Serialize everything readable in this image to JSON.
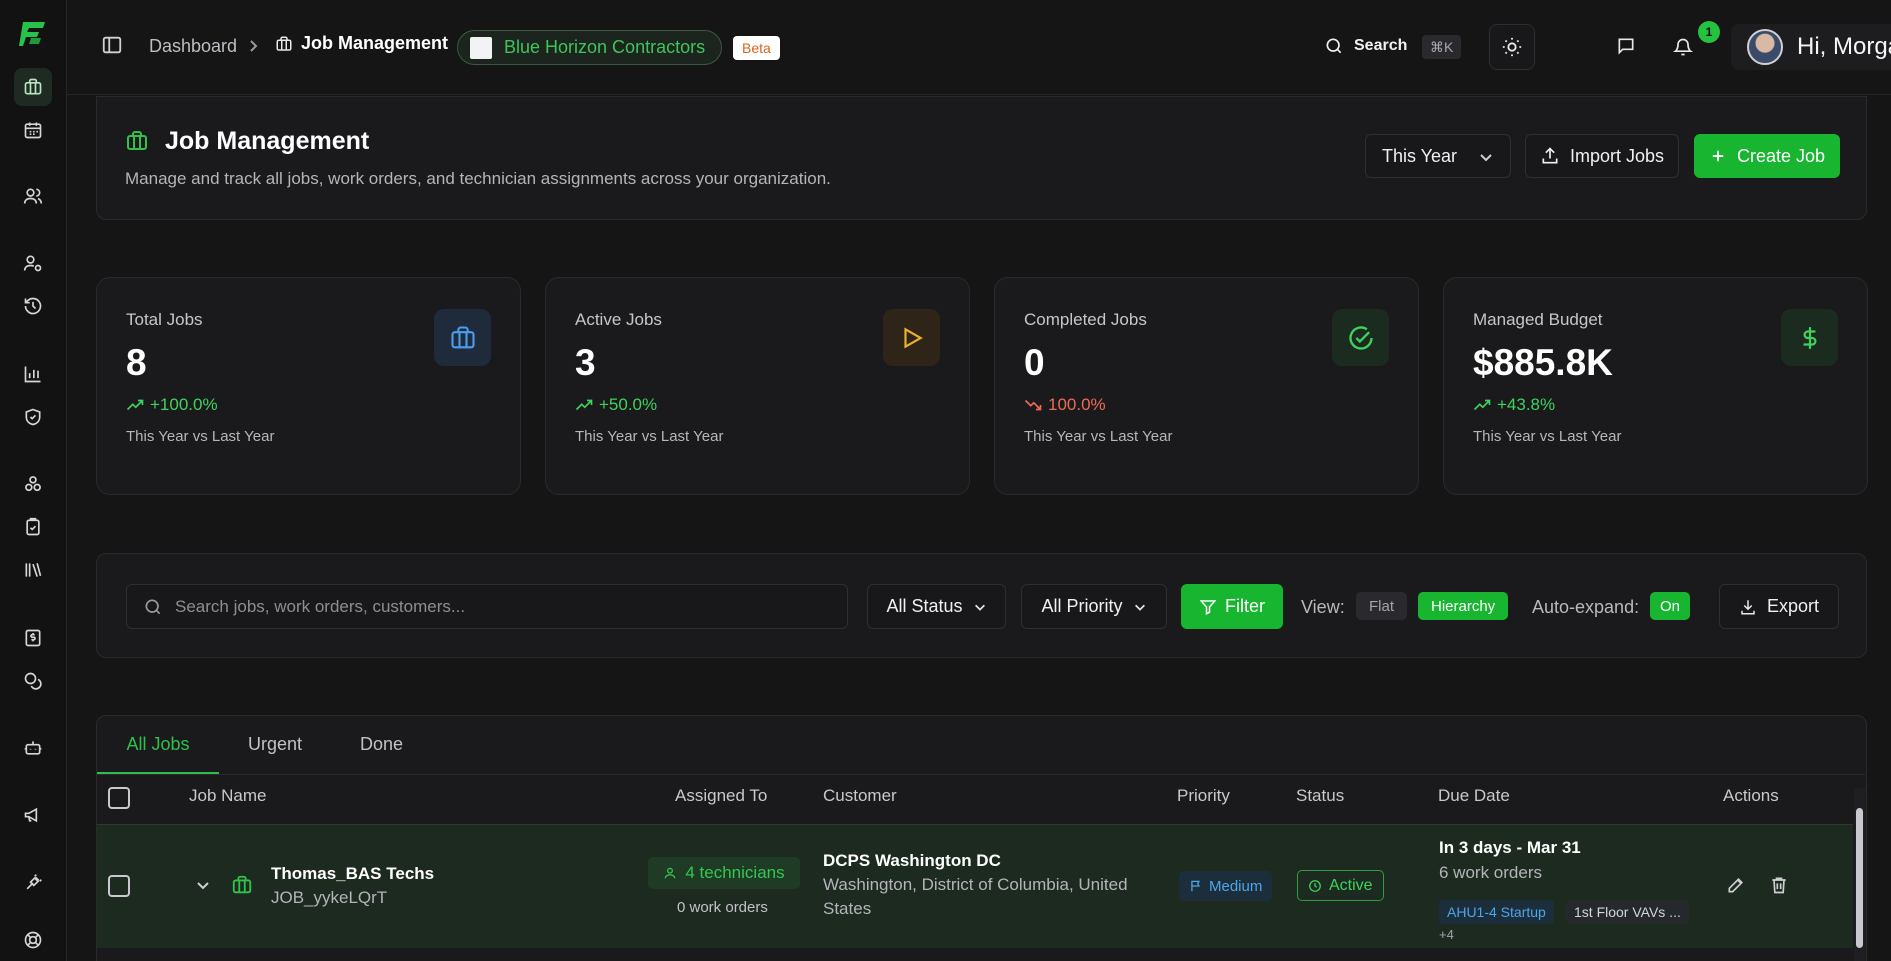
{
  "sidebar": {
    "logo_icon": "brand-logo-icon",
    "items": [
      {
        "icon": "briefcase-icon",
        "active": true
      },
      {
        "icon": "calendar-icon"
      },
      {
        "icon": "users-icon"
      },
      {
        "icon": "user-settings-icon"
      },
      {
        "icon": "history-icon"
      },
      {
        "icon": "bar-chart-icon"
      },
      {
        "icon": "shield-check-icon"
      },
      {
        "icon": "components-icon"
      },
      {
        "icon": "clipboard-check-icon"
      },
      {
        "icon": "library-icon"
      },
      {
        "icon": "invoice-icon"
      },
      {
        "icon": "coins-icon"
      },
      {
        "icon": "bot-icon"
      },
      {
        "icon": "megaphone-icon"
      },
      {
        "icon": "plug-icon"
      },
      {
        "icon": "help-icon"
      }
    ]
  },
  "topbar": {
    "breadcrumb_dashboard": "Dashboard",
    "breadcrumb_current": "Job Management",
    "org_name": "Blue Horizon Contractors",
    "beta_label": "Beta",
    "search_label": "Search",
    "search_shortcut": "⌘K",
    "notification_count": "1",
    "greeting": "Hi, Morgan"
  },
  "page_header": {
    "title": "Job Management",
    "subtitle": "Manage and track all jobs, work orders, and technician assignments across your organization.",
    "period_selected": "This Year",
    "import_label": "Import Jobs",
    "create_label": "Create Job"
  },
  "stats": [
    {
      "label": "Total Jobs",
      "value": "8",
      "change": "+100.0%",
      "trend": "up",
      "footnote": "This Year vs Last Year",
      "icon": "briefcase-icon",
      "color": "#4a9ef0"
    },
    {
      "label": "Active Jobs",
      "value": "3",
      "change": "+50.0%",
      "trend": "up",
      "footnote": "This Year vs Last Year",
      "icon": "play-icon",
      "color": "#e9b22a"
    },
    {
      "label": "Completed Jobs",
      "value": "0",
      "change": "100.0%",
      "trend": "down",
      "footnote": "This Year vs Last Year",
      "icon": "check-circle-icon",
      "color": "#3ed35d"
    },
    {
      "label": "Managed Budget",
      "value": "$885.8K",
      "change": "+43.8%",
      "trend": "up",
      "footnote": "This Year vs Last Year",
      "icon": "dollar-icon",
      "color": "#3ed35d"
    }
  ],
  "filters": {
    "search_placeholder": "Search jobs, work orders, customers...",
    "status_selected": "All Status",
    "priority_selected": "All Priority",
    "filter_label": "Filter",
    "view_label": "View:",
    "view_flat": "Flat",
    "view_hierarchy": "Hierarchy",
    "view_selected": "Hierarchy",
    "auto_expand_label": "Auto-expand:",
    "auto_expand_value": "On",
    "export_label": "Export"
  },
  "table": {
    "tabs": [
      "All Jobs",
      "Urgent",
      "Done"
    ],
    "active_tab": "All Jobs",
    "columns": [
      "Job Name",
      "Assigned To",
      "Customer",
      "Priority",
      "Status",
      "Due Date",
      "Actions"
    ],
    "rows": [
      {
        "job_name": "Thomas_BAS Techs",
        "job_id": "JOB_yykeLQrT",
        "assigned": "4 technicians",
        "assigned_work_orders": "0 work orders",
        "customer_name": "DCPS Washington DC",
        "customer_location_line1": "Washington, District of Columbia, United",
        "customer_location_line2": "States",
        "priority": "Medium",
        "status": "Active",
        "due": "In 3 days - Mar 31",
        "work_orders": "6 work orders",
        "tags": [
          "AHU1-4 Startup",
          "1st Floor VAVs ..."
        ],
        "more_tags": "+4"
      }
    ]
  },
  "colors": {
    "accent": "#17b530",
    "background": "#151516",
    "card": "#1a1a1c"
  }
}
